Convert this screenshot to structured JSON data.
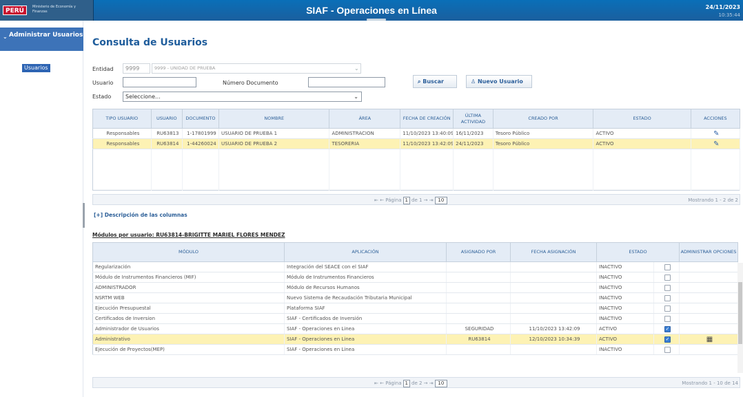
{
  "header": {
    "title": "SIAF - Operaciones en Línea",
    "date": "24/11/2023",
    "time": "10:35:44",
    "logo": {
      "peru": "PERÚ",
      "ministry": "Ministerio de Economía y Finanzas"
    }
  },
  "sidebar": {
    "section": "Administrar Usuarios",
    "item": "Usuarios"
  },
  "page": {
    "title": "Consulta de Usuarios"
  },
  "filters": {
    "entidad_label": "Entidad",
    "entidad_code": "9999",
    "entidad_name": "9999 - UNIDAD DE PRUEBA",
    "usuario_label": "Usuario",
    "usuario_value": "",
    "numdoc_label": "Número Documento",
    "numdoc_value": "",
    "estado_label": "Estado",
    "estado_value": "Seleccione..."
  },
  "buttons": {
    "buscar": "Buscar",
    "nuevo": "Nuevo Usuario"
  },
  "users_table": {
    "columns": [
      "TIPO USUARIO",
      "USUARIO",
      "DOCUMENTO",
      "NOMBRE",
      "ÁREA",
      "FECHA DE CREACIÓN",
      "ÚLTIMA ACTIVIDAD",
      "CREADO POR",
      "ESTADO",
      "ACCIONES"
    ],
    "rows": [
      [
        "Responsables",
        "RU63813",
        "1-17801999",
        "USUARIO DE PRUEBA 1",
        "ADMINISTRACION",
        "11/10/2023 13:40:09",
        "16/11/2023",
        "Tesoro Público",
        "ACTIVO"
      ],
      [
        "Responsables",
        "RU63814",
        "1-44260024",
        "USUARIO DE PRUEBA 2",
        "TESORERIA",
        "11/10/2023 13:42:09",
        "24/11/2023",
        "Tesoro Público",
        "ACTIVO"
      ]
    ],
    "pager": {
      "pagina": "Página",
      "page": "1",
      "de": "de 1",
      "size": "10",
      "showing": "Mostrando 1 - 2 de 2"
    }
  },
  "desc_link": "[+] Descripción de las columnas",
  "modules_title": "Módulos por usuario: RU63814-BRIGITTE MARIEL FLORES MENDEZ",
  "modules_table": {
    "columns": [
      "MÓDULO",
      "APLICACIÓN",
      "ASIGNADO POR",
      "FECHA ASIGNACIÓN",
      "ESTADO",
      "ADMINISTRAR OPCIONES"
    ],
    "rows": [
      [
        "Regularización",
        "Integración del SEACE con el SIAF",
        "",
        "",
        "INACTIVO",
        false
      ],
      [
        "Módulo de Instrumentos Financieros (MIF)",
        "Módulo de Instrumentos Financieros",
        "",
        "",
        "INACTIVO",
        false
      ],
      [
        "ADMINISTRADOR",
        "Módulo de Recursos Humanos",
        "",
        "",
        "INACTIVO",
        false
      ],
      [
        "NSRTM WEB",
        "Nuevo Sistema de Recaudación Tributaria Municipal",
        "",
        "",
        "INACTIVO",
        false
      ],
      [
        "Ejecución Presupuestal",
        "Plataforma SIAF",
        "",
        "",
        "INACTIVO",
        false
      ],
      [
        "Certificados de Inversion",
        "SIAF - Certificados de Inversión",
        "",
        "",
        "INACTIVO",
        false
      ],
      [
        "Administrador de Usuarios",
        "SIAF - Operaciones en Linea",
        "SEGURIDAD",
        "11/10/2023 13:42:09",
        "ACTIVO",
        true
      ],
      [
        "Administrativo",
        "SIAF - Operaciones en Linea",
        "RU63814",
        "12/10/2023 10:34:39",
        "ACTIVO",
        true
      ],
      [
        "Ejecución de Proyectos(MEP)",
        "SIAF - Operaciones en Linea",
        "",
        "",
        "INACTIVO",
        false
      ]
    ],
    "pager": {
      "pagina": "Página",
      "page": "1",
      "de": "de 2",
      "size": "10",
      "showing": "Mostrando 1 - 10 de 14"
    }
  }
}
